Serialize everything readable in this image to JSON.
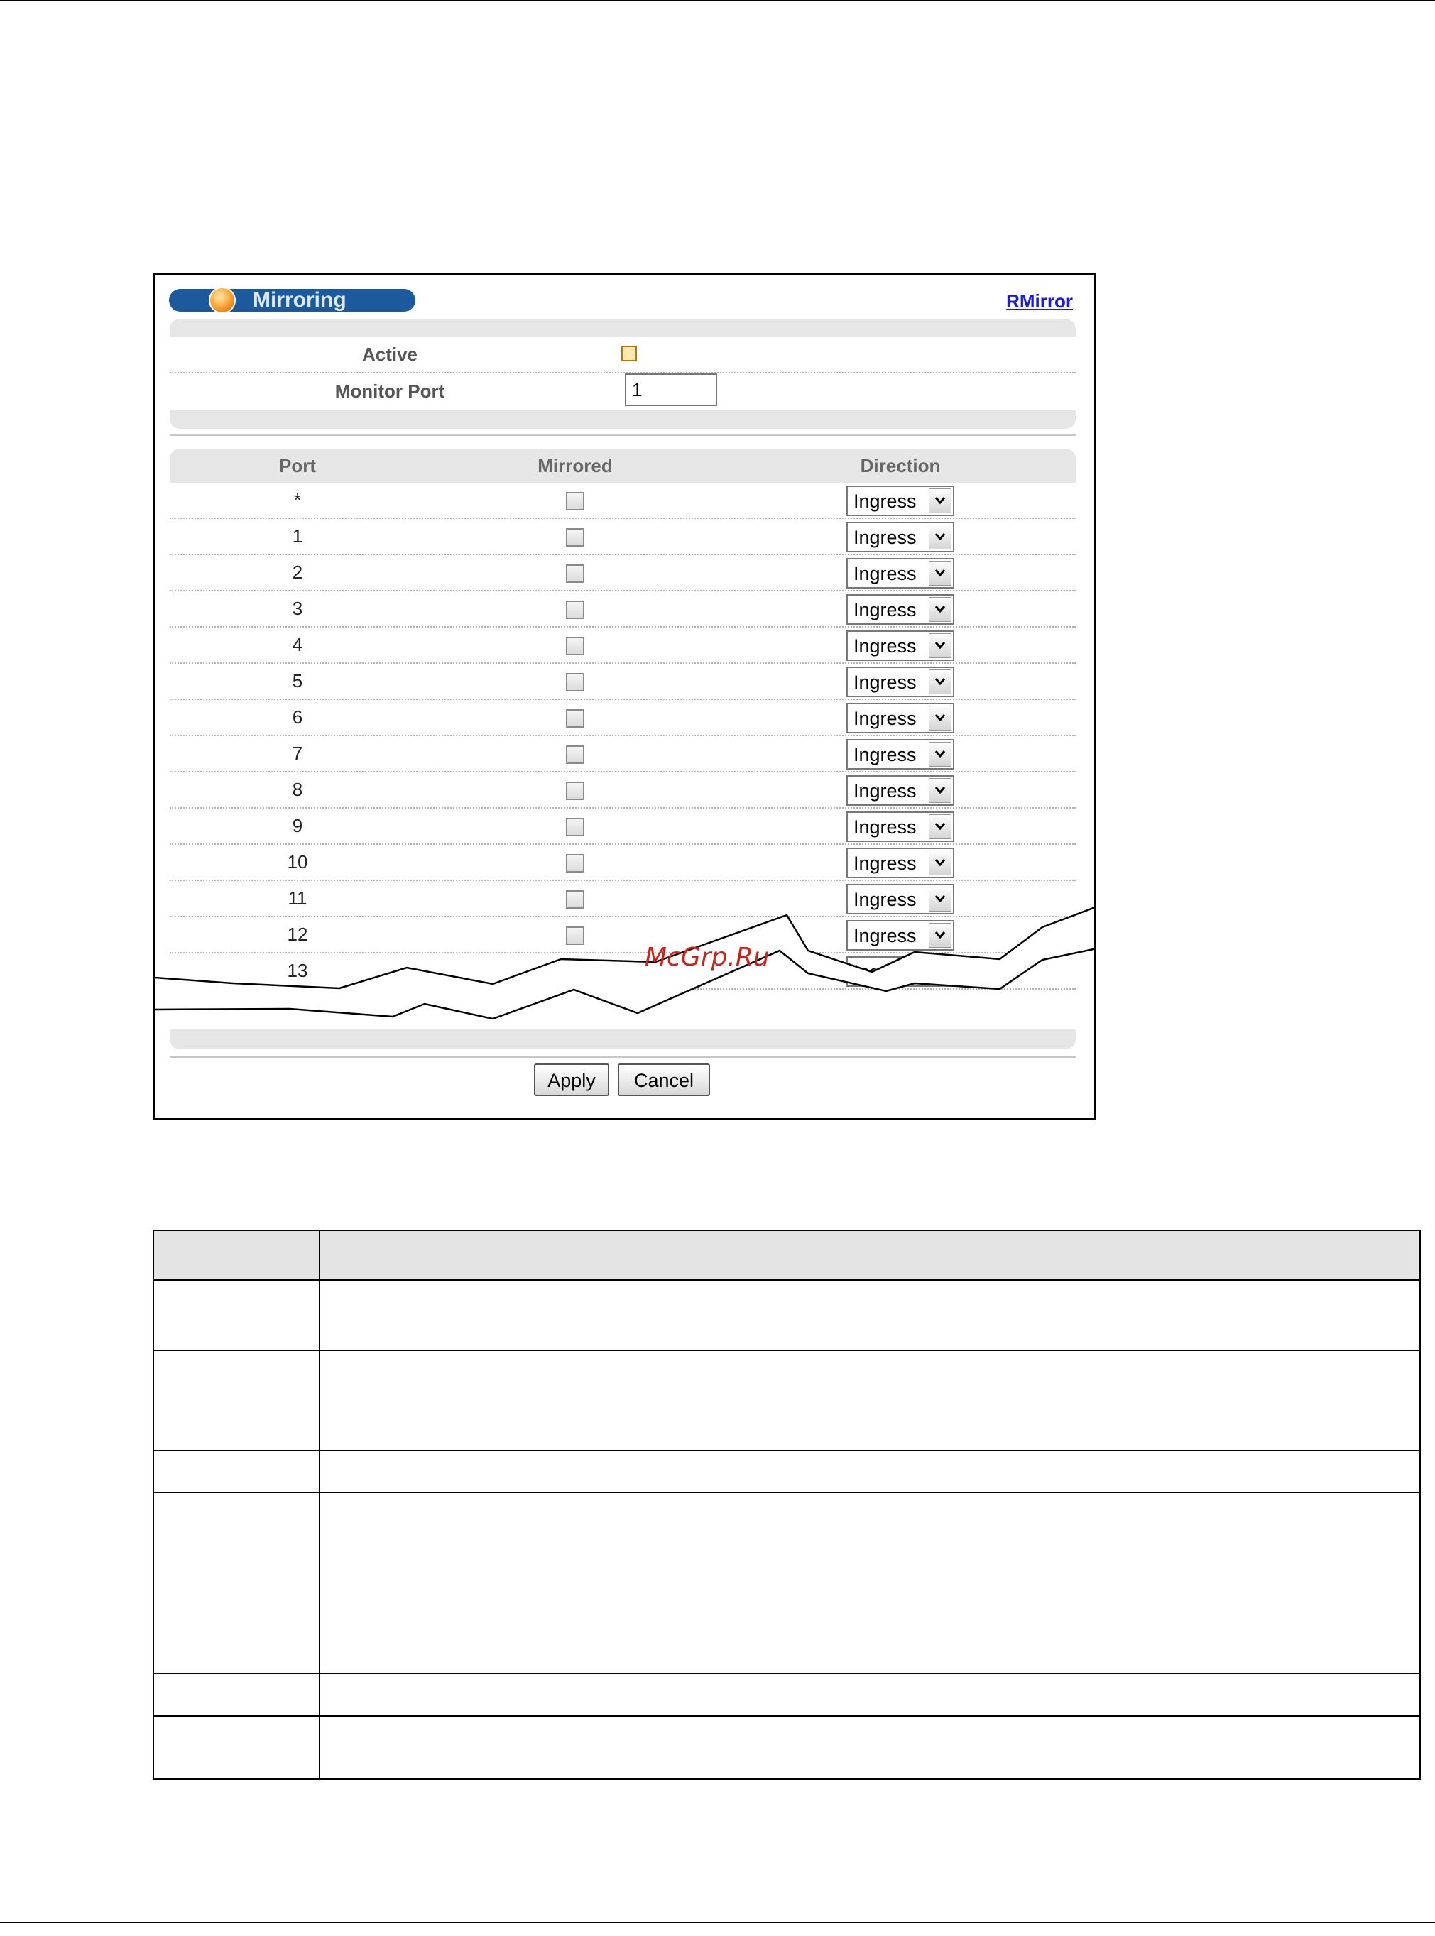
{
  "panel": {
    "title": "Mirroring",
    "rmirror_link": "RMirror",
    "active_label": "Active",
    "monitor_port_label": "Monitor Port",
    "monitor_port_value": "1"
  },
  "ports_table": {
    "headers": {
      "port": "Port",
      "mirrored": "Mirrored",
      "direction": "Direction"
    },
    "rows": [
      {
        "port": "*",
        "direction": "Ingress"
      },
      {
        "port": "1",
        "direction": "Ingress"
      },
      {
        "port": "2",
        "direction": "Ingress"
      },
      {
        "port": "3",
        "direction": "Ingress"
      },
      {
        "port": "4",
        "direction": "Ingress"
      },
      {
        "port": "5",
        "direction": "Ingress"
      },
      {
        "port": "6",
        "direction": "Ingress"
      },
      {
        "port": "7",
        "direction": "Ingress"
      },
      {
        "port": "8",
        "direction": "Ingress"
      },
      {
        "port": "9",
        "direction": "Ingress"
      },
      {
        "port": "10",
        "direction": "Ingress"
      },
      {
        "port": "11",
        "direction": "Ingress"
      },
      {
        "port": "12",
        "direction": "Ingress"
      },
      {
        "port": "13",
        "direction": "Ingress"
      }
    ]
  },
  "buttons": {
    "apply": "Apply",
    "cancel": "Cancel"
  },
  "watermark": "McGrp.Ru",
  "colors": {
    "title_bar": "#1c5a9d",
    "link": "#1a1adc",
    "watermark": "#c8241a"
  }
}
